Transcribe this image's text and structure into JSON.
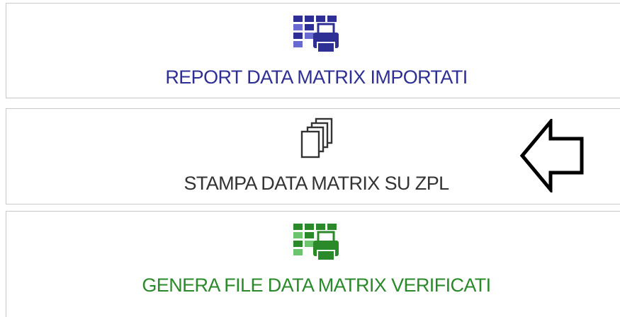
{
  "tiles": [
    {
      "label": "REPORT DATA MATRIX IMPORTATI",
      "icon": "barcode-printer-icon",
      "color": "#2e2f95"
    },
    {
      "label": "STAMPA DATA MATRIX SU ZPL",
      "icon": "copy-stack-icon",
      "color": "#333333"
    },
    {
      "label": "GENERA FILE DATA MATRIX VERIFICATI",
      "icon": "barcode-printer-icon",
      "color": "#2a8a2a"
    }
  ],
  "annotation": {
    "icon": "left-arrow-icon"
  }
}
